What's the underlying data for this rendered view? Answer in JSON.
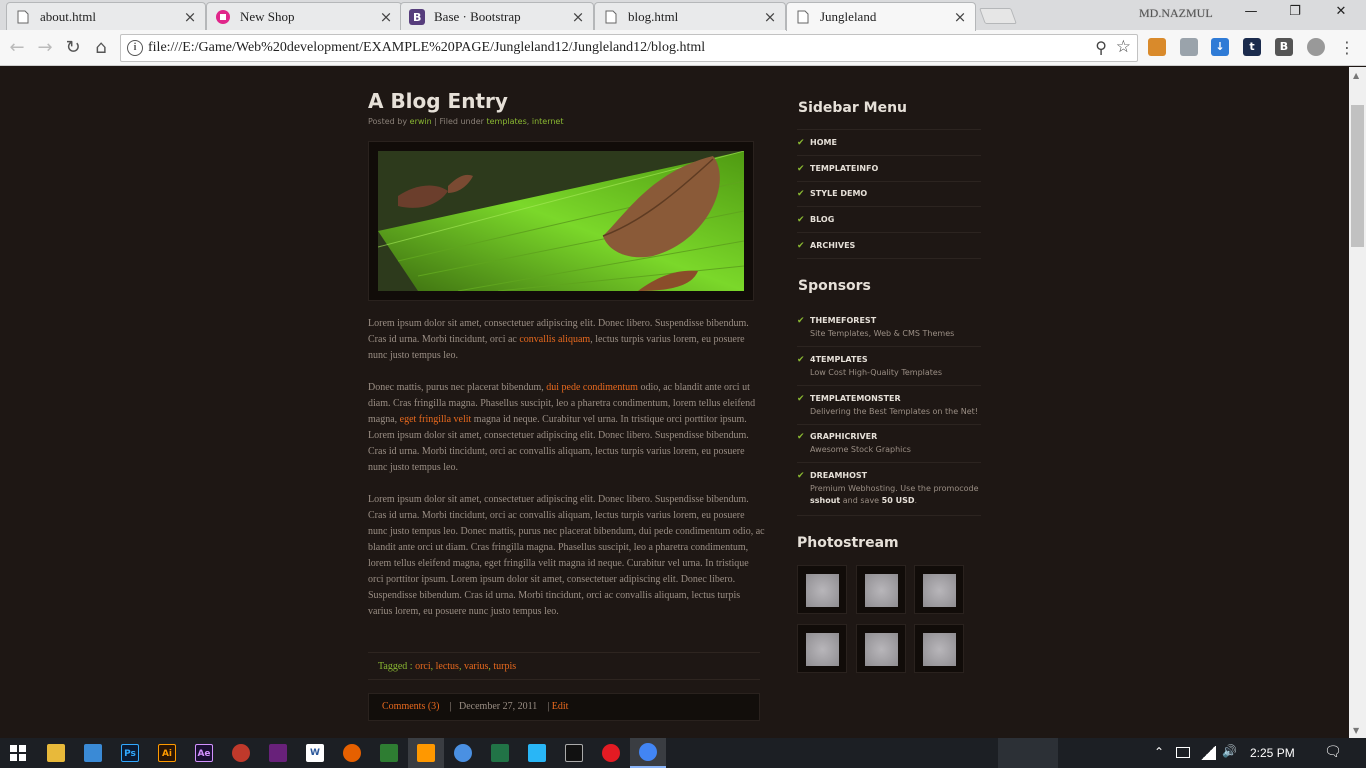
{
  "browser": {
    "tabs": [
      {
        "title": "about.html",
        "icon": "page-icon"
      },
      {
        "title": "New Shop",
        "icon": "shop-icon"
      },
      {
        "title": "Base · Bootstrap",
        "icon": "bootstrap-icon"
      },
      {
        "title": "blog.html",
        "icon": "page-icon"
      },
      {
        "title": "Jungleland",
        "icon": "page-icon",
        "active": true
      }
    ],
    "profile_name": "MD.NAZMUL",
    "url": "file:///E:/Game/Web%20development/EXAMPLE%20PAGE/Jungleland12/Jungleland12/blog.html",
    "window_controls": {
      "minimize": "—",
      "restore": "❐",
      "close": "✕"
    },
    "nav": {
      "back": "←",
      "forward": "→",
      "reload": "↻",
      "home": "⌂"
    },
    "info_glyph": "i",
    "zoom_glyph": "⚲",
    "star_glyph": "☆"
  },
  "post": {
    "title": "A Blog Entry",
    "meta": {
      "posted_by_label": "Posted by",
      "author": "erwin",
      "filed_label": "| Filed under",
      "cat1": "templates",
      "sep": ",",
      "cat2": "internet"
    },
    "p1": {
      "a": "Lorem ipsum dolor sit amet, consectetuer adipiscing elit. Donec libero. Suspendisse bibendum. Cras id urna. Morbi tincidunt, orci ac ",
      "link": "convallis aliquam",
      "b": ", lectus turpis varius lorem, eu posuere nunc justo tempus leo."
    },
    "p2": {
      "a": "Donec mattis, purus nec placerat bibendum, ",
      "link1": "dui pede condimentum",
      "b": " odio, ac blandit ante orci ut diam. Cras fringilla magna. Phasellus suscipit, leo a pharetra condimentum, lorem tellus eleifend magna, ",
      "link2": "eget fringilla velit",
      "c": " magna id neque. Curabitur vel urna. In tristique orci porttitor ipsum. Lorem ipsum dolor sit amet, consectetuer adipiscing elit. Donec libero. Suspendisse bibendum. Cras id urna. Morbi tincidunt, orci ac convallis aliquam, lectus turpis varius lorem, eu posuere nunc justo tempus leo."
    },
    "p3": "Lorem ipsum dolor sit amet, consectetuer adipiscing elit. Donec libero. Suspendisse bibendum. Cras id urna. Morbi tincidunt, orci ac convallis aliquam, lectus turpis varius lorem, eu posuere nunc justo tempus leo. Donec mattis, purus nec placerat bibendum, dui pede condimentum odio, ac blandit ante orci ut diam. Cras fringilla magna. Phasellus suscipit, leo a pharetra condimentum, lorem tellus eleifend magna, eget fringilla velit magna id neque. Curabitur vel urna. In tristique orci porttitor ipsum. Lorem ipsum dolor sit amet, consectetuer adipiscing elit. Donec libero. Suspendisse bibendum. Cras id urna. Morbi tincidunt, orci ac convallis aliquam, lectus turpis varius lorem, eu posuere nunc justo tempus leo.",
    "tags_label": "Tagged :",
    "tags": [
      "orci",
      "lectus",
      "varius",
      "turpis"
    ],
    "footer": {
      "comments": "Comments (3)",
      "sep1": "|",
      "date": "December 27, 2011",
      "sep2": "|",
      "edit": "Edit"
    }
  },
  "sidebar": {
    "menu_title": "Sidebar Menu",
    "menu": [
      "HOME",
      "TEMPLATEINFO",
      "STYLE DEMO",
      "BLOG",
      "ARCHIVES"
    ],
    "sponsors_title": "Sponsors",
    "sponsors": [
      {
        "name": "THEMEFOREST",
        "desc": "Site Templates, Web & CMS Themes"
      },
      {
        "name": "4TEMPLATES",
        "desc": "Low Cost High-Quality Templates"
      },
      {
        "name": "TEMPLATEMONSTER",
        "desc": "Delivering the Best Templates on the Net!"
      },
      {
        "name": "GRAPHICRIVER",
        "desc": "Awesome Stock Graphics"
      },
      {
        "name": "DREAMHOST",
        "desc_a": "Premium Webhosting. Use the promocode",
        "desc_code": "sshout",
        "desc_b": "and save",
        "desc_amt": "50 USD",
        "desc_end": "."
      }
    ],
    "photostream_title": "Photostream",
    "check_glyph": "✔"
  },
  "taskbar": {
    "clock": "2:25 PM",
    "apps": [
      "Ps",
      "Ai",
      "Ae",
      "W"
    ],
    "tray": {
      "chevron": "⌃",
      "volume": "🔊",
      "notifications": "🗨"
    }
  },
  "colors": {
    "accent_orange": "#e8691e",
    "accent_green": "#8ab832",
    "page_bg": "#1e1714"
  }
}
